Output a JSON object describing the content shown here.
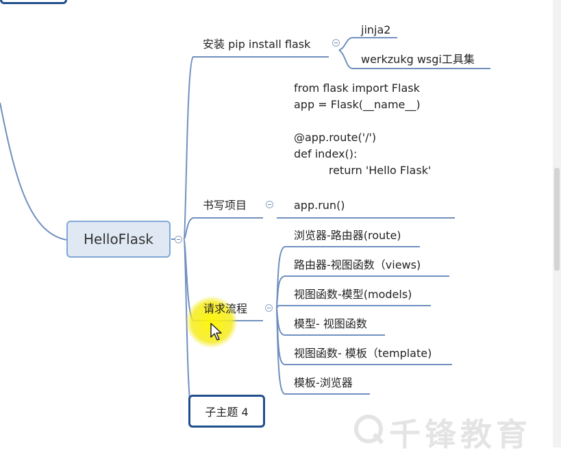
{
  "root": {
    "label": "HelloFlask"
  },
  "branches": {
    "install": {
      "label": "安装  pip install flask",
      "children": [
        "jinja2",
        "werkzukg wsgi工具集"
      ]
    },
    "write": {
      "label": "书写项目",
      "code": "from flask import Flask\napp = Flask(__name__)\n\n@app.route('/')\ndef index():\n          return 'Hello Flask'",
      "child": "app.run()"
    },
    "request": {
      "label": "请求流程",
      "children": [
        "浏览器-路由器(route)",
        "路由器-视图函数（views)",
        "视图函数-模型(models)",
        "模型- 视图函数",
        "视图函数- 模板（template)",
        "模板-浏览器"
      ]
    },
    "sub4": {
      "label": "子主题 4"
    }
  },
  "watermark": {
    "text": "千锋教育"
  },
  "colors": {
    "line": "#6f8fbf",
    "root_fill": "#dfe8f3",
    "root_border": "#7fa7d6",
    "sub4_border": "#1f4e8c",
    "highlight": "#f5ea1e"
  }
}
